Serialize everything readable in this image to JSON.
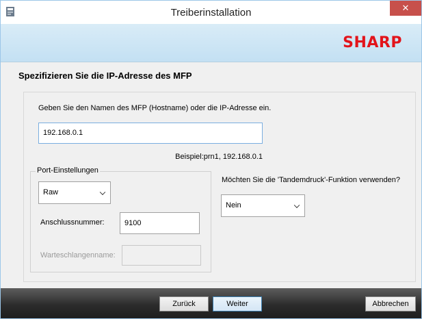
{
  "window": {
    "title": "Treiberinstallation",
    "close_glyph": "✕",
    "app_icon": "installer-icon"
  },
  "banner": {
    "logo_text": "SHARP",
    "logo_color": "#e2141b"
  },
  "heading": "Spezifizieren Sie die IP-Adresse des MFP",
  "address": {
    "instruction": "Geben Sie den Namen des MFP (Hostname) oder die IP-Adresse ein.",
    "value": "192.168.0.1",
    "example": "Beispiel:prn1, 192.168.0.1"
  },
  "port": {
    "group_label": "Port-Einstellungen",
    "protocol_selected": "Raw",
    "port_number_label": "Anschlussnummer:",
    "port_number_value": "9100",
    "queue_name_label": "Warteschlangenname:",
    "queue_name_value": ""
  },
  "tandem": {
    "question": "Möchten Sie die 'Tandemdruck'-Funktion verwenden?",
    "selected": "Nein"
  },
  "footer": {
    "back_label": "Zurück",
    "next_label": "Weiter",
    "cancel_label": "Abbrechen"
  }
}
